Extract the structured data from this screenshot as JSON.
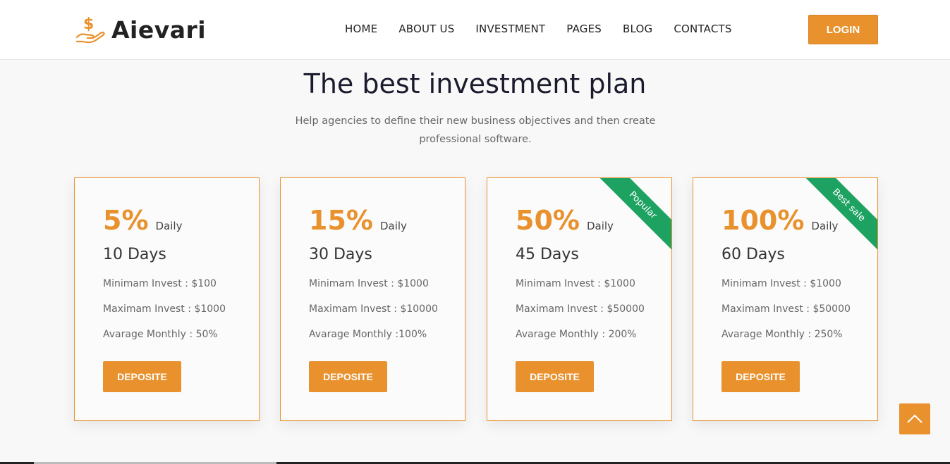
{
  "brand": {
    "name": "Aievari"
  },
  "nav": {
    "items": [
      "HOME",
      "ABOUT US",
      "INVESTMENT",
      "PAGES",
      "BLOG",
      "CONTACTS"
    ],
    "login_label": "LOGIN"
  },
  "section": {
    "title": "The best investment plan",
    "subtitle": "Help agencies to define their new business objectives and then create professional software."
  },
  "plans": [
    {
      "percent": "5%",
      "period": "Daily",
      "days": "10 Days",
      "min": "Minimam Invest : $100",
      "max": "Maximam Invest : $1000",
      "monthly": "Avarage Monthly : 50%",
      "button": "DEPOSITE",
      "ribbon": ""
    },
    {
      "percent": "15%",
      "period": "Daily",
      "days": "30 Days",
      "min": "Minimam Invest : $1000",
      "max": "Maximam Invest : $10000",
      "monthly": "Avarage Monthly :100%",
      "button": "DEPOSITE",
      "ribbon": ""
    },
    {
      "percent": "50%",
      "period": "Daily",
      "days": "45 Days",
      "min": "Minimam Invest : $1000",
      "max": "Maximam Invest : $50000",
      "monthly": "Avarage Monthly : 200%",
      "button": "DEPOSITE",
      "ribbon": "Popular"
    },
    {
      "percent": "100%",
      "period": "Daily",
      "days": "60 Days",
      "min": "Minimam Invest : $1000",
      "max": "Maximam Invest : $50000",
      "monthly": "Avarage Monthly : 250%",
      "button": "DEPOSITE",
      "ribbon": "Best sale"
    }
  ],
  "icons": {
    "logo": "hand-dollar-icon",
    "scroll_top": "chevron-up-icon"
  },
  "colors": {
    "accent": "#e8912d",
    "ribbon": "#1ea261",
    "heading": "#1b1b2e"
  }
}
